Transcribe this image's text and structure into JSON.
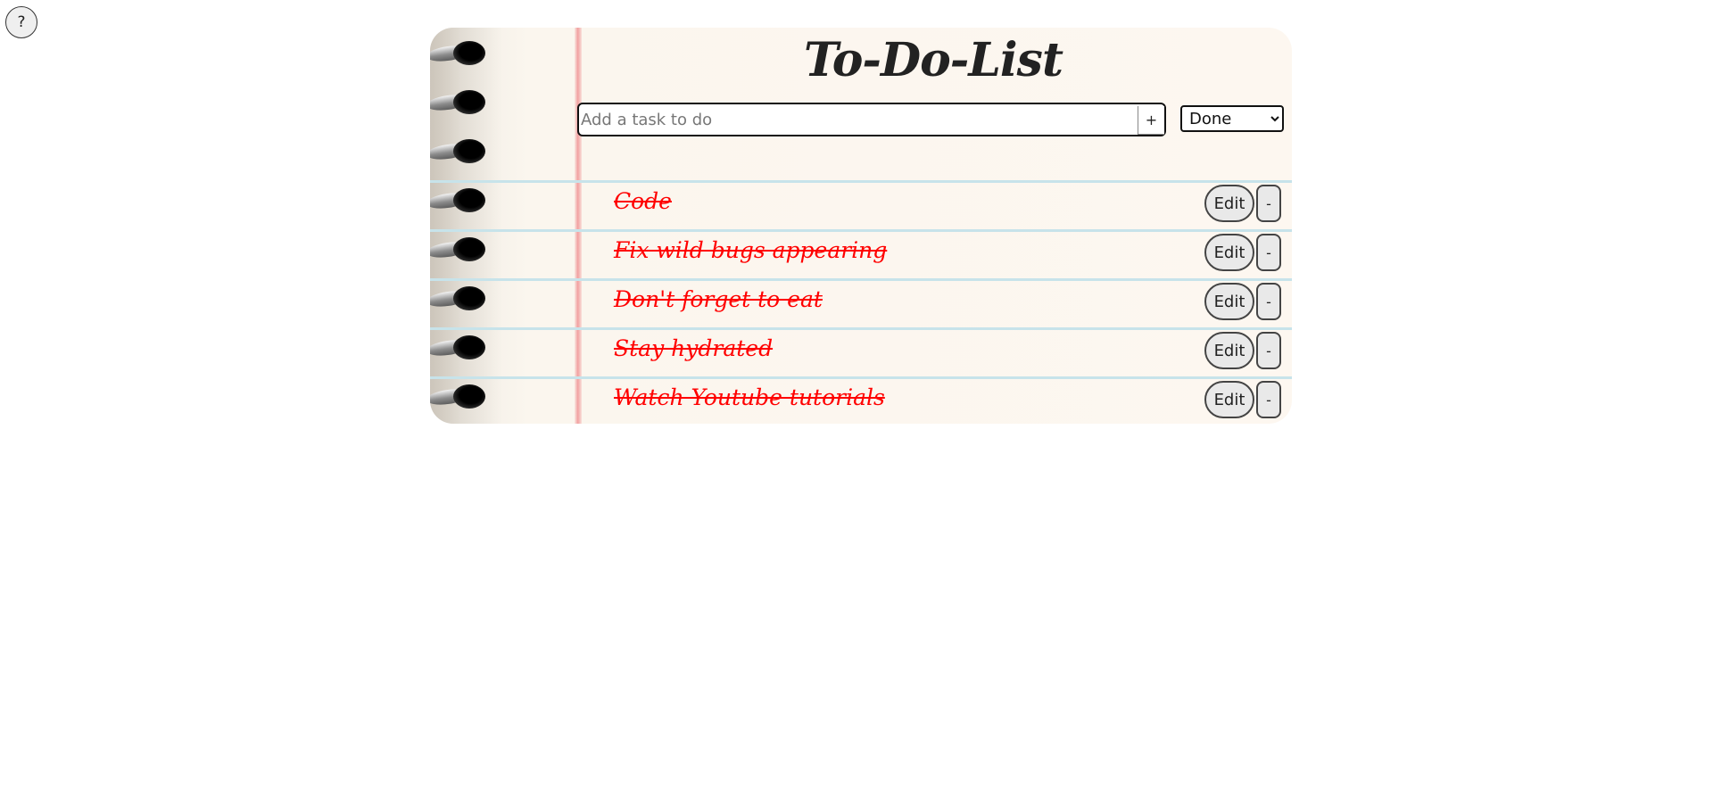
{
  "help": {
    "label": "?"
  },
  "header": {
    "title": "To-Do-List"
  },
  "add_task": {
    "placeholder": "Add a task to do",
    "value": "",
    "add_label": "+"
  },
  "filter": {
    "selected": "Done"
  },
  "tasks": [
    {
      "text": "Code",
      "status": "done",
      "edit_label": "Edit",
      "remove_label": "-"
    },
    {
      "text": "Fix wild bugs appearing",
      "status": "done",
      "edit_label": "Edit",
      "remove_label": "-"
    },
    {
      "text": "Don't forget to eat",
      "status": "done",
      "edit_label": "Edit",
      "remove_label": "-"
    },
    {
      "text": "Stay hydrated",
      "status": "done",
      "edit_label": "Edit",
      "remove_label": "-"
    },
    {
      "text": "Watch Youtube tutorials",
      "status": "done",
      "edit_label": "Edit",
      "remove_label": "-"
    }
  ],
  "colors": {
    "done_text": "#ff0000",
    "paper": "#fdf7f0",
    "margin_line": "#f2a0a0",
    "ruled_line": "#c7e3ea"
  },
  "icons": {
    "spiral_ring": "spiral-ring-icon"
  }
}
